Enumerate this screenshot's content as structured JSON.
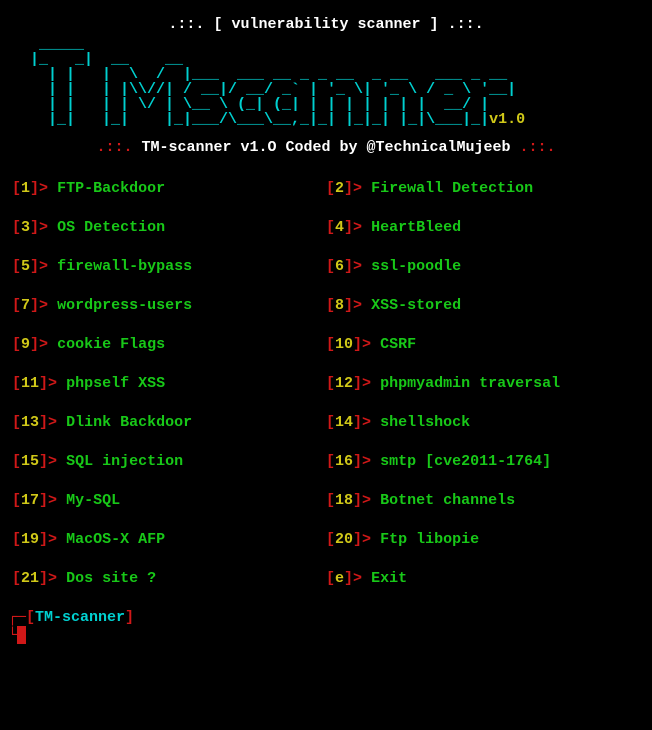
{
  "header": {
    "dots_left": ".::.",
    "bracket_l": "[",
    "title": "vulnerability scanner",
    "bracket_r": "]",
    "dots_right": ".::."
  },
  "logo": {
    "version": "v1.0"
  },
  "subtitle": {
    "dots_left": ".::.",
    "text": "TM-scanner v1.O Coded by @TechnicalMujeeb",
    "dots_right": ".::."
  },
  "menu": [
    {
      "num": "1",
      "label": "FTP-Backdoor"
    },
    {
      "num": "2",
      "label": "Firewall Detection"
    },
    {
      "num": "3",
      "label": "OS Detection"
    },
    {
      "num": "4",
      "label": "HeartBleed"
    },
    {
      "num": "5",
      "label": "firewall-bypass"
    },
    {
      "num": "6",
      "label": "ssl-poodle"
    },
    {
      "num": "7",
      "label": "wordpress-users"
    },
    {
      "num": "8",
      "label": "XSS-stored"
    },
    {
      "num": "9",
      "label": "cookie Flags"
    },
    {
      "num": "10",
      "label": "CSRF"
    },
    {
      "num": "11",
      "label": "phpself XSS"
    },
    {
      "num": "12",
      "label": "phpmyadmin traversal"
    },
    {
      "num": "13",
      "label": "Dlink Backdoor"
    },
    {
      "num": "14",
      "label": "shellshock"
    },
    {
      "num": "15",
      "label": "SQL injection"
    },
    {
      "num": "16",
      "label": "smtp [cve2011-1764]"
    },
    {
      "num": "17",
      "label": "My-SQL"
    },
    {
      "num": "18",
      "label": "Botnet channels"
    },
    {
      "num": "19",
      "label": "MacOS-X AFP"
    },
    {
      "num": "20",
      "label": "Ftp libopie"
    },
    {
      "num": "21",
      "label": "Dos site ?"
    },
    {
      "num": "e",
      "label": "Exit"
    }
  ],
  "prompt": {
    "corner": "┌─",
    "bracket_l": "[",
    "name": "TM-scanner",
    "bracket_r": "]",
    "pipe": "└"
  }
}
